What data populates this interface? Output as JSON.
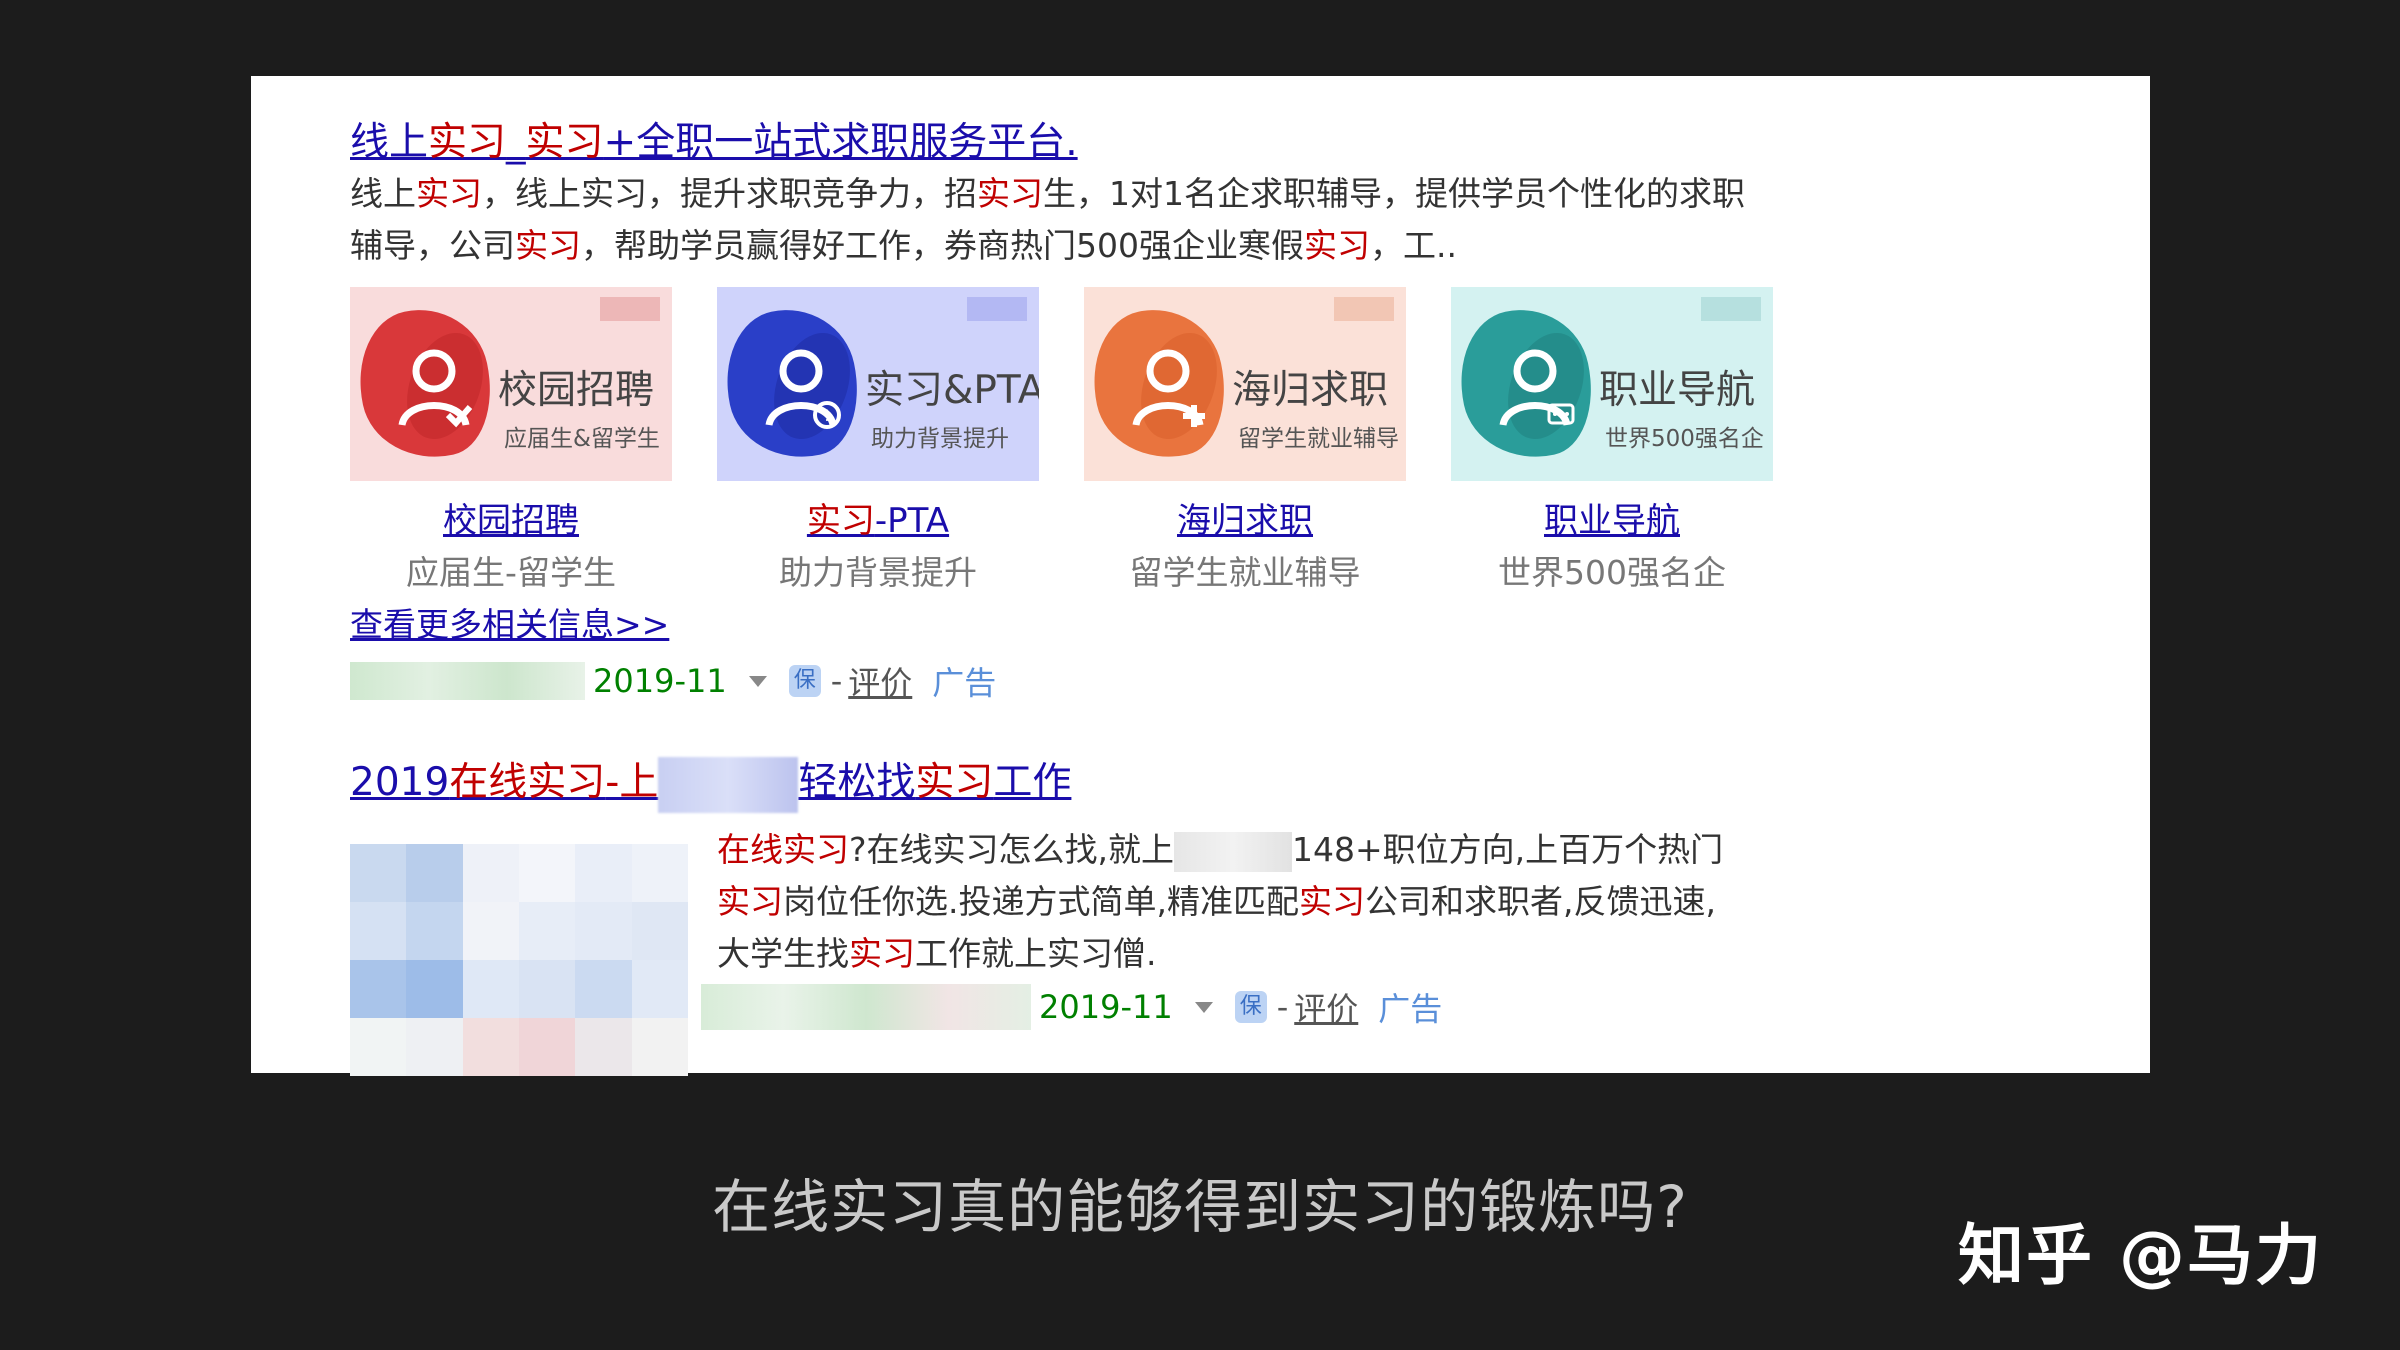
{
  "result1": {
    "title_parts": [
      "线上",
      "实习",
      "_",
      "实习",
      "+全职一站式求职服务平台."
    ],
    "desc_line1": [
      "线上",
      "实习",
      "，线上实习，提升求职竞争力，招",
      "实习",
      "生，1对1名企求职辅导，提供学员个性化的求职"
    ],
    "desc_line2": [
      "辅导，公司",
      "实习",
      "，帮助学员赢得好工作，券商热门500强企业寒假",
      "实习",
      "，工.."
    ],
    "tiles": [
      {
        "big": "校园招聘",
        "small": "应届生&留学生",
        "link": "校园招聘",
        "sub": "应届生-留学生",
        "color": "#d9383a"
      },
      {
        "big": "实习&PTA",
        "small": "助力背景提升",
        "link_parts": [
          "实习",
          "-PTA"
        ],
        "sub": "助力背景提升",
        "color": "#2a3fc8"
      },
      {
        "big": "海归求职",
        "small": "留学生就业辅导",
        "link": "海归求职",
        "sub": "留学生就业辅导",
        "color": "#e9743e"
      },
      {
        "big": "职业导航",
        "small": "世界500强名企",
        "link": "职业导航",
        "sub": "世界500强名企",
        "color": "#2a9d9a"
      }
    ],
    "more_link": "查看更多相关信息>>",
    "date": "2019-11",
    "bao": "保",
    "dash": "-",
    "eval": "评价",
    "ad": "广告"
  },
  "result2": {
    "title_parts": [
      "2019",
      "在线实习",
      "-上",
      "轻松找",
      "实习",
      "工作"
    ],
    "desc_line1": [
      "在线实习",
      "?在线实习怎么找,就上",
      "148+职位方向,上百万个热门"
    ],
    "desc_line2": [
      "实习",
      "岗位任你选.投递方式简单,精准匹配",
      "实习",
      "公司和求职者,反馈迅速,"
    ],
    "desc_line3": [
      "大学生找",
      "实习",
      "工作就上实习僧."
    ],
    "date": "2019-11",
    "bao": "保",
    "dash": "-",
    "eval": "评价",
    "ad": "广告"
  },
  "caption": "在线实习真的能够得到实习的锻炼吗?",
  "brand": "知乎 @马力"
}
